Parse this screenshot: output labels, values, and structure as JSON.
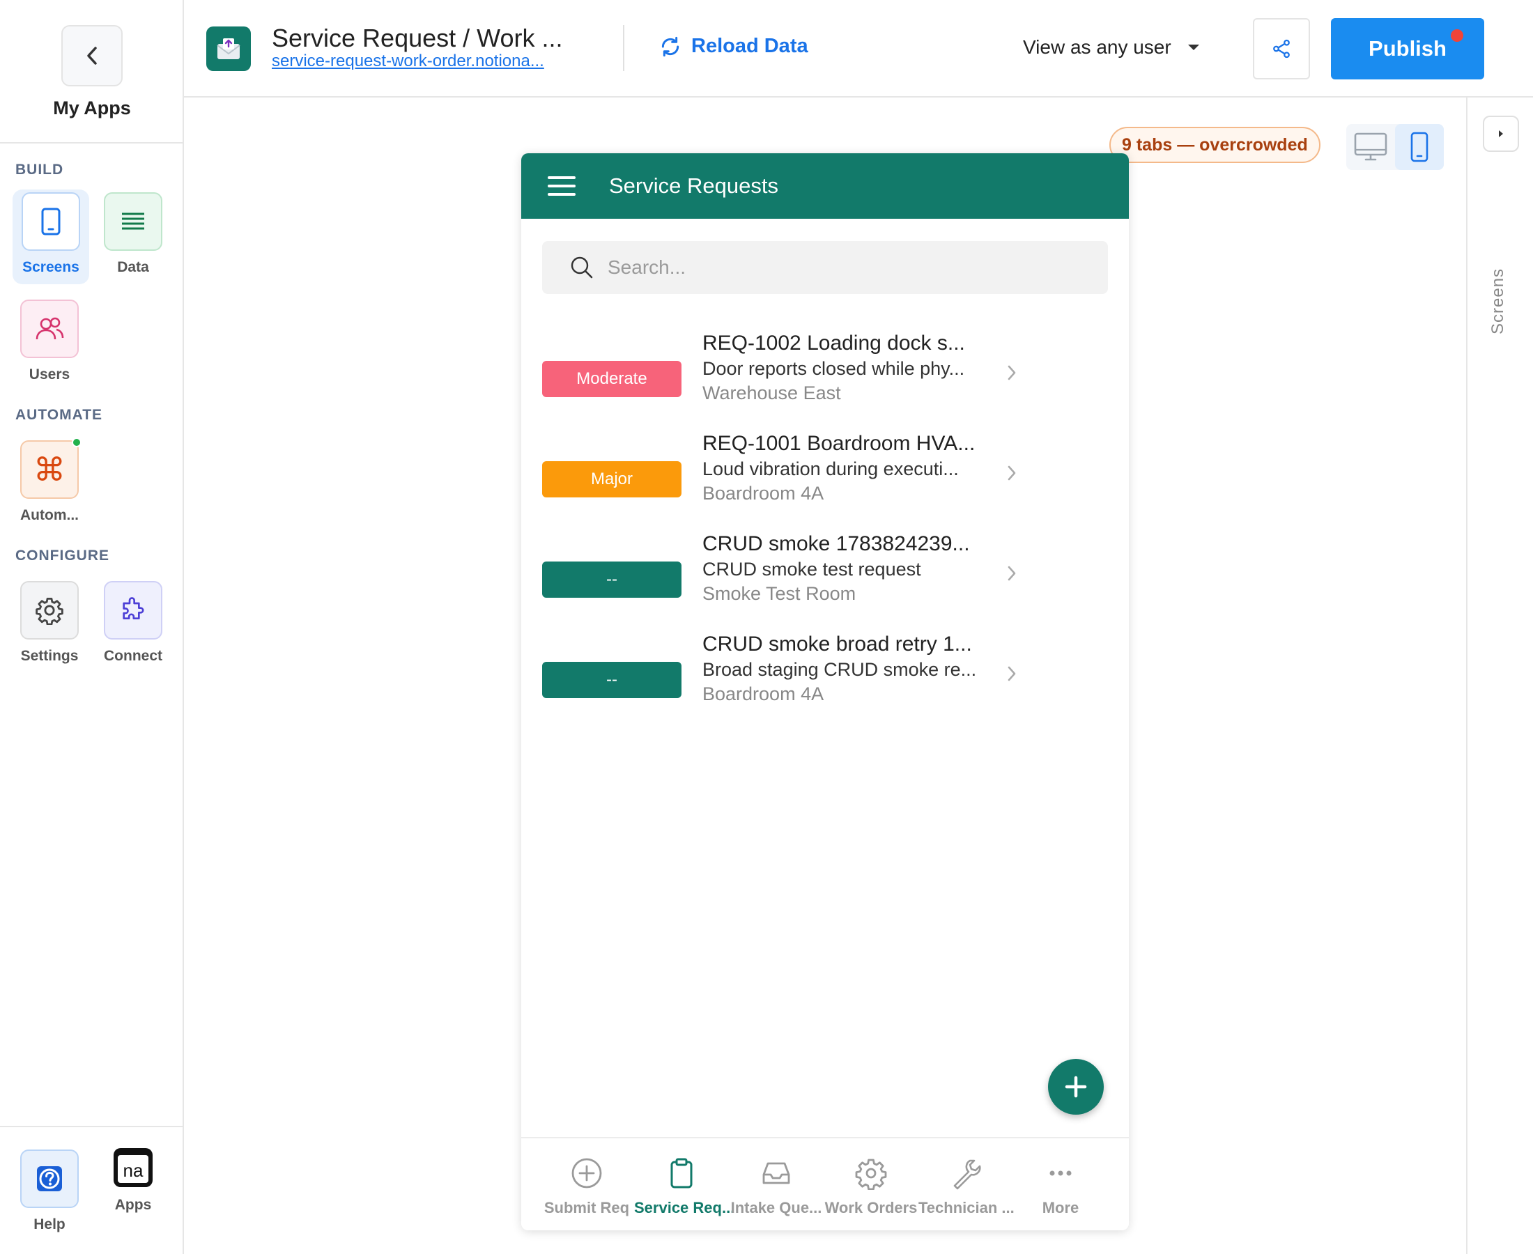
{
  "sidebar": {
    "back_label": "My Apps",
    "sections": {
      "build": "BUILD",
      "automate": "AUTOMATE",
      "configure": "CONFIGURE"
    },
    "items": {
      "screens": "Screens",
      "data": "Data",
      "users": "Users",
      "automations": "Autom...",
      "settings": "Settings",
      "connect": "Connect",
      "help": "Help",
      "apps": "Apps"
    }
  },
  "topbar": {
    "app_title": "Service Request / Work ...",
    "app_url": "service-request-work-order.notiona...",
    "reload_label": "Reload Data",
    "view_as_label": "View as any user",
    "publish_label": "Publish"
  },
  "canvas": {
    "warning_pill": "9 tabs — overcrowded",
    "rail_label": "Screens"
  },
  "phone": {
    "header_title": "Service Requests",
    "search_placeholder": "Search...",
    "rows": [
      {
        "badge": "Moderate",
        "badge_color": "#f7637a",
        "title": "REQ-1002 Loading dock s...",
        "subtitle": "Door reports closed while phy...",
        "location": "Warehouse East"
      },
      {
        "badge": "Major",
        "badge_color": "#fb9a0b",
        "title": "REQ-1001 Boardroom HVA...",
        "subtitle": "Loud vibration during executi...",
        "location": "Boardroom 4A"
      },
      {
        "badge": "--",
        "badge_color": "#127a6a",
        "title": "CRUD smoke 1783824239...",
        "subtitle": "CRUD smoke test request",
        "location": "Smoke Test Room"
      },
      {
        "badge": "--",
        "badge_color": "#127a6a",
        "title": "CRUD smoke broad retry 1...",
        "subtitle": "Broad staging CRUD smoke re...",
        "location": "Boardroom 4A"
      }
    ],
    "tabs": [
      {
        "label": "Submit Req",
        "icon": "plus-circle-icon"
      },
      {
        "label": "Service Req...",
        "icon": "clipboard-icon",
        "active": true
      },
      {
        "label": "Intake Que...",
        "icon": "inbox-icon"
      },
      {
        "label": "Work Orders",
        "icon": "gear-icon"
      },
      {
        "label": "Technician ...",
        "icon": "wrench-icon"
      },
      {
        "label": "More",
        "icon": "more-dots-icon"
      }
    ]
  },
  "colors": {
    "brand_teal": "#127a6a",
    "accent_blue": "#1a73e8",
    "publish_blue": "#1a8cf0",
    "warning_text": "#a8400f"
  }
}
